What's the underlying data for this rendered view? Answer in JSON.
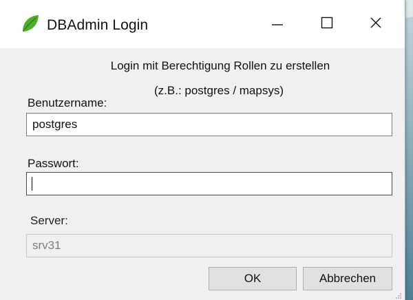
{
  "window": {
    "title": "DBAdmin Login",
    "icon": "leaf-icon"
  },
  "titlebar_buttons": {
    "minimize": "minimize-icon",
    "maximize": "maximize-icon",
    "close": "close-icon"
  },
  "form": {
    "hint_line1": "Login mit Berechtigung Rollen zu erstellen",
    "hint_line2": "(z.B.: postgres / mapsys)",
    "username_label": "Benutzername:",
    "username_value": "postgres",
    "password_label": "Passwort:",
    "password_value": "",
    "server_label": "Server:",
    "server_value": "srv31"
  },
  "buttons": {
    "ok_label": "OK",
    "cancel_label": "Abbrechen"
  },
  "colors": {
    "icon_green": "#4cae2b",
    "window_bg": "#f0f0f0",
    "titlebar_bg": "#ffffff"
  }
}
